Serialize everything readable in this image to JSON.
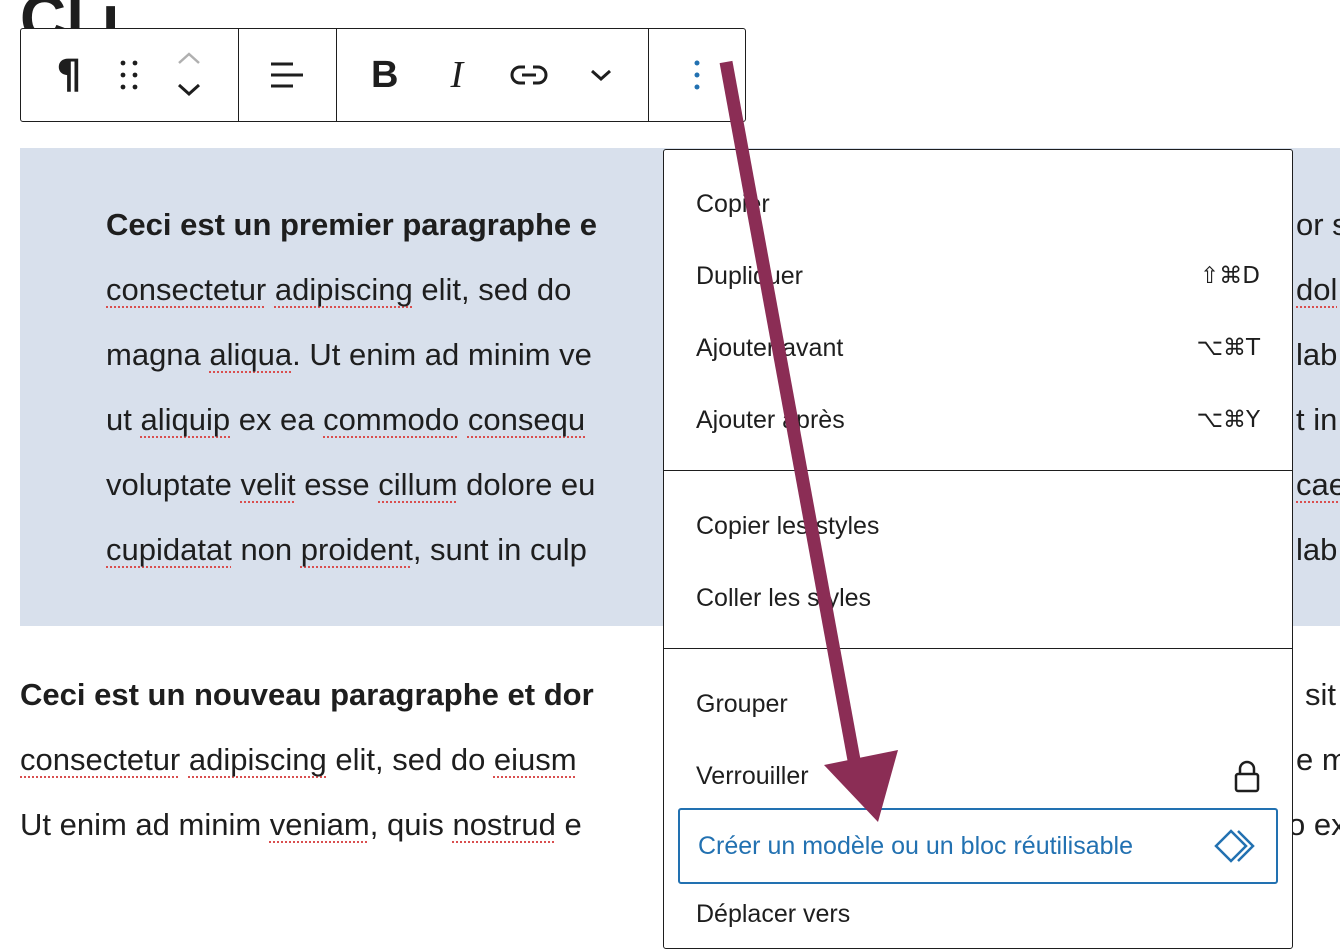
{
  "page": {
    "title_fragment": "Cl   i"
  },
  "toolbar": {
    "paragraph_icon": "¶",
    "bold_label": "B",
    "italic_label": "I"
  },
  "paragraph1": {
    "line1_bold": "Ceci est un premier paragraphe e",
    "line2": [
      "consectetur",
      " ",
      "adipiscing",
      " elit, sed do "
    ],
    "line3": [
      "magna ",
      "aliqua",
      ". Ut enim ad minim ve"
    ],
    "line4": [
      "ut ",
      "aliquip",
      " ex ea ",
      "commodo",
      " ",
      "consequ"
    ],
    "line5": [
      "voluptate ",
      "velit",
      " esse ",
      "cillum",
      " dolore eu"
    ],
    "line6": [
      "cupidatat",
      " non ",
      "proident",
      ", sunt in culp"
    ],
    "right": [
      "or s",
      "dol",
      "lab",
      "t in",
      "cae",
      "lab"
    ]
  },
  "paragraph2": {
    "line1_bold": "Ceci est un nouveau paragraphe et dor",
    "line2": [
      "consectetur",
      " ",
      "adipiscing",
      " elit, sed do ",
      "eiusm"
    ],
    "line3": [
      "Ut enim ad minim ",
      "veniam",
      ", quis ",
      "nostrud",
      " e"
    ],
    "right": [
      "sit",
      "e m",
      "o ex"
    ]
  },
  "menu": {
    "section1": [
      {
        "label": "Copier",
        "shortcut": ""
      },
      {
        "label": "Dupliquer",
        "shortcut": "⇧⌘D"
      },
      {
        "label": "Ajouter avant",
        "shortcut": "⌥⌘T"
      },
      {
        "label": "Ajouter après",
        "shortcut": "⌥⌘Y"
      }
    ],
    "section2": [
      {
        "label": "Copier les styles"
      },
      {
        "label": "Coller les styles"
      }
    ],
    "section3": [
      {
        "label": "Grouper"
      },
      {
        "label": "Verrouiller"
      },
      {
        "label": "Créer un modèle ou un bloc réutilisable"
      },
      {
        "label": "Déplacer vers"
      }
    ]
  },
  "colors": {
    "accent": "#2271b1",
    "selection_bg": "#d8e0ec",
    "arrow": "#8b2d55",
    "spell_underline": "#d94f4f"
  }
}
